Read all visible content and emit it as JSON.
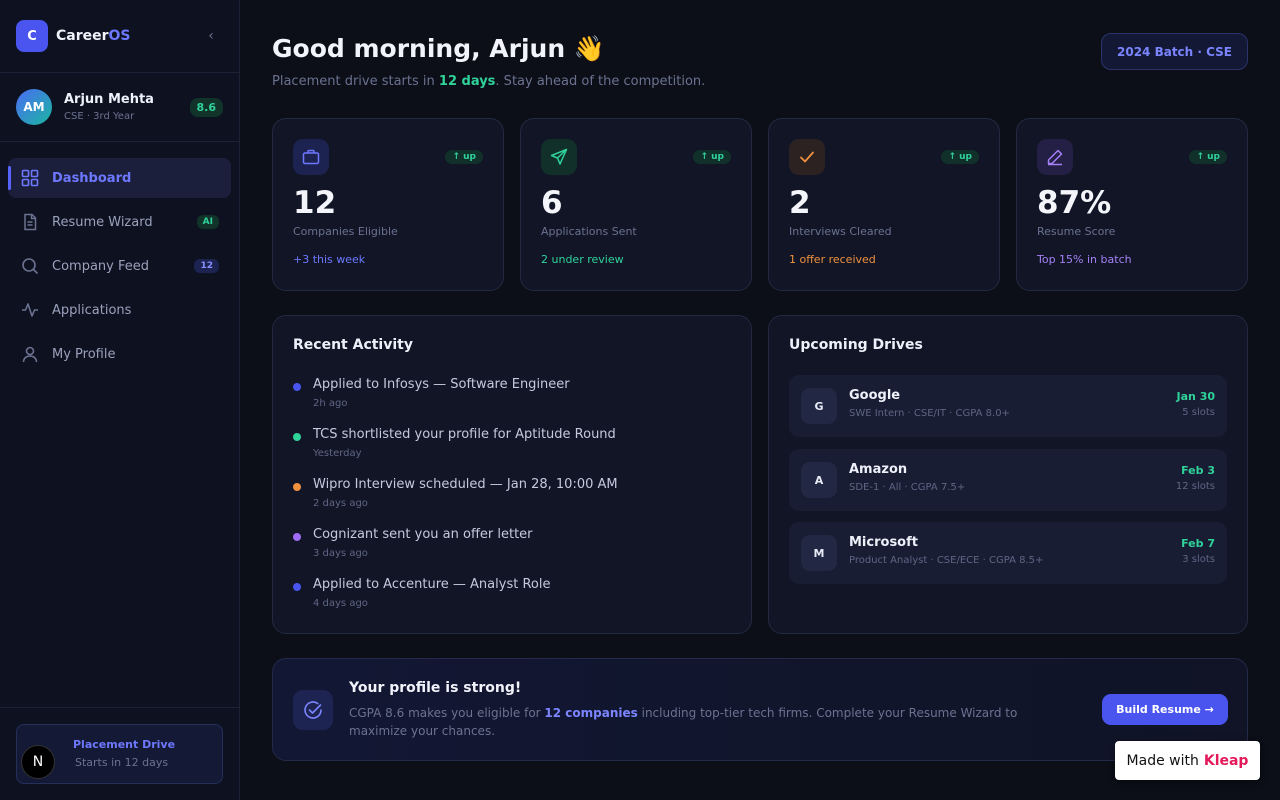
{
  "app": {
    "logo_letter": "C",
    "name_prefix": "Career",
    "name_suffix": "OS",
    "collapse_glyph": "‹"
  },
  "user": {
    "initials": "AM",
    "name": "Arjun Mehta",
    "sub": "CSE · 3rd Year",
    "cgpa": "8.6"
  },
  "nav": [
    {
      "label": "Dashboard",
      "icon": "grid-icon",
      "active": true
    },
    {
      "label": "Resume Wizard",
      "icon": "document-icon",
      "badge": "AI"
    },
    {
      "label": "Company Feed",
      "icon": "search-icon",
      "badge": "12"
    },
    {
      "label": "Applications",
      "icon": "activity-icon"
    },
    {
      "label": "My Profile",
      "icon": "user-icon"
    }
  ],
  "sidebar_card": {
    "badge_letter": "N",
    "title": "Placement Drive",
    "sub": "Starts in 12 days"
  },
  "header": {
    "greeting": "Good morning, Arjun 👋",
    "sub_prefix": "Placement drive starts in ",
    "sub_highlight": "12 days",
    "sub_suffix": ". Stay ahead of the competition.",
    "batch": "2024 Batch · CSE"
  },
  "stats": [
    {
      "icon": "briefcase-icon",
      "up": "↑ up",
      "value": "12",
      "label": "Companies Eligible",
      "note": "+3 this week",
      "note_color": "#6d78ff",
      "icon_bg": "#1c2350"
    },
    {
      "icon": "send-icon",
      "up": "↑ up",
      "value": "6",
      "label": "Applications Sent",
      "note": "2 under review",
      "note_color": "#2fd39a",
      "icon_bg": "#12302a"
    },
    {
      "icon": "check-icon",
      "up": "↑ up",
      "value": "2",
      "label": "Interviews Cleared",
      "note": "1 offer received",
      "note_color": "#f0913d",
      "icon_bg": "#2c2222"
    },
    {
      "icon": "pen-icon",
      "up": "↑ up",
      "value": "87%",
      "label": "Resume Score",
      "note": "Top 15% in batch",
      "note_color": "#a480f5",
      "icon_bg": "#241f44"
    }
  ],
  "activity": {
    "title": "Recent Activity",
    "items": [
      {
        "text": "Applied to Infosys — Software Engineer",
        "time": "2h ago",
        "color": "#4a55f0"
      },
      {
        "text": "TCS shortlisted your profile for Aptitude Round",
        "time": "Yesterday",
        "color": "#2fd39a"
      },
      {
        "text": "Wipro Interview scheduled — Jan 28, 10:00 AM",
        "time": "2 days ago",
        "color": "#f0913d"
      },
      {
        "text": "Cognizant sent you an offer letter",
        "time": "3 days ago",
        "color": "#9d6cf5"
      },
      {
        "text": "Applied to Accenture — Analyst Role",
        "time": "4 days ago",
        "color": "#4a55f0"
      }
    ]
  },
  "drives": {
    "title": "Upcoming Drives",
    "items": [
      {
        "logo": "G",
        "name": "Google",
        "meta": "SWE Intern · CSE/IT · CGPA 8.0+",
        "date": "Jan 30",
        "slots": "5 slots"
      },
      {
        "logo": "A",
        "name": "Amazon",
        "meta": "SDE-1 · All · CGPA 7.5+",
        "date": "Feb 3",
        "slots": "12 slots"
      },
      {
        "logo": "M",
        "name": "Microsoft",
        "meta": "Product Analyst · CSE/ECE · CGPA 8.5+",
        "date": "Feb 7",
        "slots": "3 slots"
      }
    ]
  },
  "banner": {
    "title": "Your profile is strong!",
    "text_prefix": "CGPA 8.6 makes you eligible for ",
    "text_highlight": "12 companies",
    "text_suffix": " including top-tier tech firms. Complete your Resume Wizard to maximize your chances.",
    "button": "Build Resume →"
  },
  "watermark": {
    "prefix": "Made with",
    "brand": "Kleap"
  }
}
